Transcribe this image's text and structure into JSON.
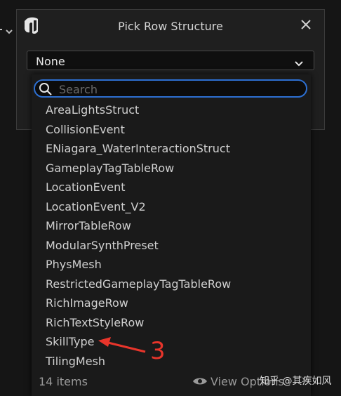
{
  "dialog": {
    "title": "Pick Row Structure",
    "selected_value": "None"
  },
  "search": {
    "placeholder": "Search"
  },
  "rows": [
    "AreaLightsStruct",
    "CollisionEvent",
    "ENiagara_WaterInteractionStruct",
    "GameplayTagTableRow",
    "LocationEvent",
    "LocationEvent_V2",
    "MirrorTableRow",
    "ModularSynthPreset",
    "PhysMesh",
    "RestrictedGameplayTagTableRow",
    "RichImageRow",
    "RichTextStyleRow",
    "SkillType",
    "TilingMesh"
  ],
  "footer": {
    "count": "14 items",
    "view_options": "View Options"
  },
  "annotation": {
    "number": "3",
    "color": "#e8352b"
  },
  "watermark": "知乎 @其疾如风",
  "icons": {
    "logo": "unreal-engine-logo-icon",
    "close": "close-icon",
    "chevron": "chevron-down-icon",
    "search": "search-icon",
    "eye": "eye-icon"
  },
  "colors": {
    "accent": "#2d6fd1",
    "background": "#151515",
    "panel": "#1a1a1a"
  }
}
